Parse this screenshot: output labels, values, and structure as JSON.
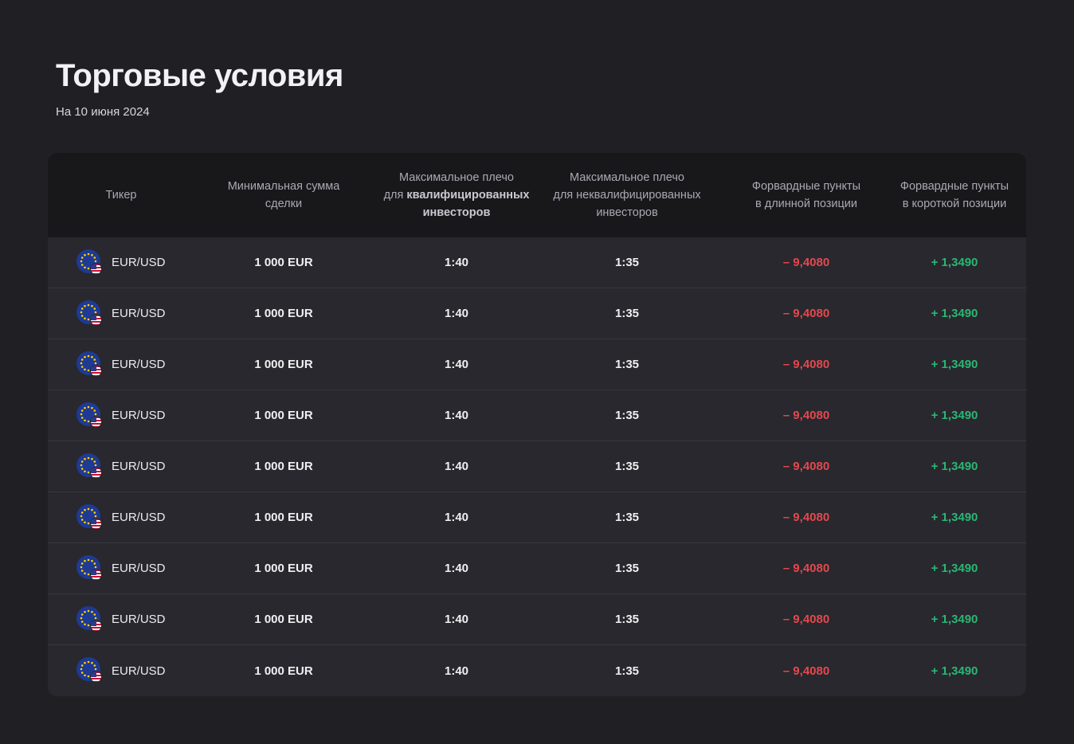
{
  "page": {
    "title": "Торговые условия",
    "subtitle": "На 10 июня 2024"
  },
  "table": {
    "headers": {
      "ticker": "Тикер",
      "min_amount_l1": "Минимальная сумма",
      "min_amount_l2": "сделки",
      "max_lev_q_l1": "Максимальное плечо",
      "max_lev_q_l2a": "для ",
      "max_lev_q_l2b": "квалифицированных",
      "max_lev_q_l3": "инвесторов",
      "max_lev_nq_l1": "Максимальное плечо",
      "max_lev_nq_l2": "для неквалифицированных",
      "max_lev_nq_l3": "инвесторов",
      "fwd_long_l1": "Форвардные пункты",
      "fwd_long_l2": "в длинной позиции",
      "fwd_short_l1": "Форвардные пункты",
      "fwd_short_l2": "в короткой позиции"
    },
    "rows": [
      {
        "ticker": "EUR/USD",
        "min_amount": "1 000 EUR",
        "lev_q": "1:40",
        "lev_nq": "1:35",
        "fwd_long": "– 9,4080",
        "fwd_short": "+ 1,3490"
      },
      {
        "ticker": "EUR/USD",
        "min_amount": "1 000 EUR",
        "lev_q": "1:40",
        "lev_nq": "1:35",
        "fwd_long": "– 9,4080",
        "fwd_short": "+ 1,3490"
      },
      {
        "ticker": "EUR/USD",
        "min_amount": "1 000 EUR",
        "lev_q": "1:40",
        "lev_nq": "1:35",
        "fwd_long": "– 9,4080",
        "fwd_short": "+ 1,3490"
      },
      {
        "ticker": "EUR/USD",
        "min_amount": "1 000 EUR",
        "lev_q": "1:40",
        "lev_nq": "1:35",
        "fwd_long": "– 9,4080",
        "fwd_short": "+ 1,3490"
      },
      {
        "ticker": "EUR/USD",
        "min_amount": "1 000 EUR",
        "lev_q": "1:40",
        "lev_nq": "1:35",
        "fwd_long": "– 9,4080",
        "fwd_short": "+ 1,3490"
      },
      {
        "ticker": "EUR/USD",
        "min_amount": "1 000 EUR",
        "lev_q": "1:40",
        "lev_nq": "1:35",
        "fwd_long": "– 9,4080",
        "fwd_short": "+ 1,3490"
      },
      {
        "ticker": "EUR/USD",
        "min_amount": "1 000 EUR",
        "lev_q": "1:40",
        "lev_nq": "1:35",
        "fwd_long": "– 9,4080",
        "fwd_short": "+ 1,3490"
      },
      {
        "ticker": "EUR/USD",
        "min_amount": "1 000 EUR",
        "lev_q": "1:40",
        "lev_nq": "1:35",
        "fwd_long": "– 9,4080",
        "fwd_short": "+ 1,3490"
      },
      {
        "ticker": "EUR/USD",
        "min_amount": "1 000 EUR",
        "lev_q": "1:40",
        "lev_nq": "1:35",
        "fwd_long": "– 9,4080",
        "fwd_short": "+ 1,3490"
      }
    ]
  },
  "icons": {
    "base_currency": "eu-flag-icon",
    "quote_currency": "us-flag-icon"
  },
  "colors": {
    "negative": "#e5484d",
    "positive": "#2bb673",
    "background": "#202024",
    "table_bg": "#28282e",
    "header_bg": "#18181b"
  }
}
